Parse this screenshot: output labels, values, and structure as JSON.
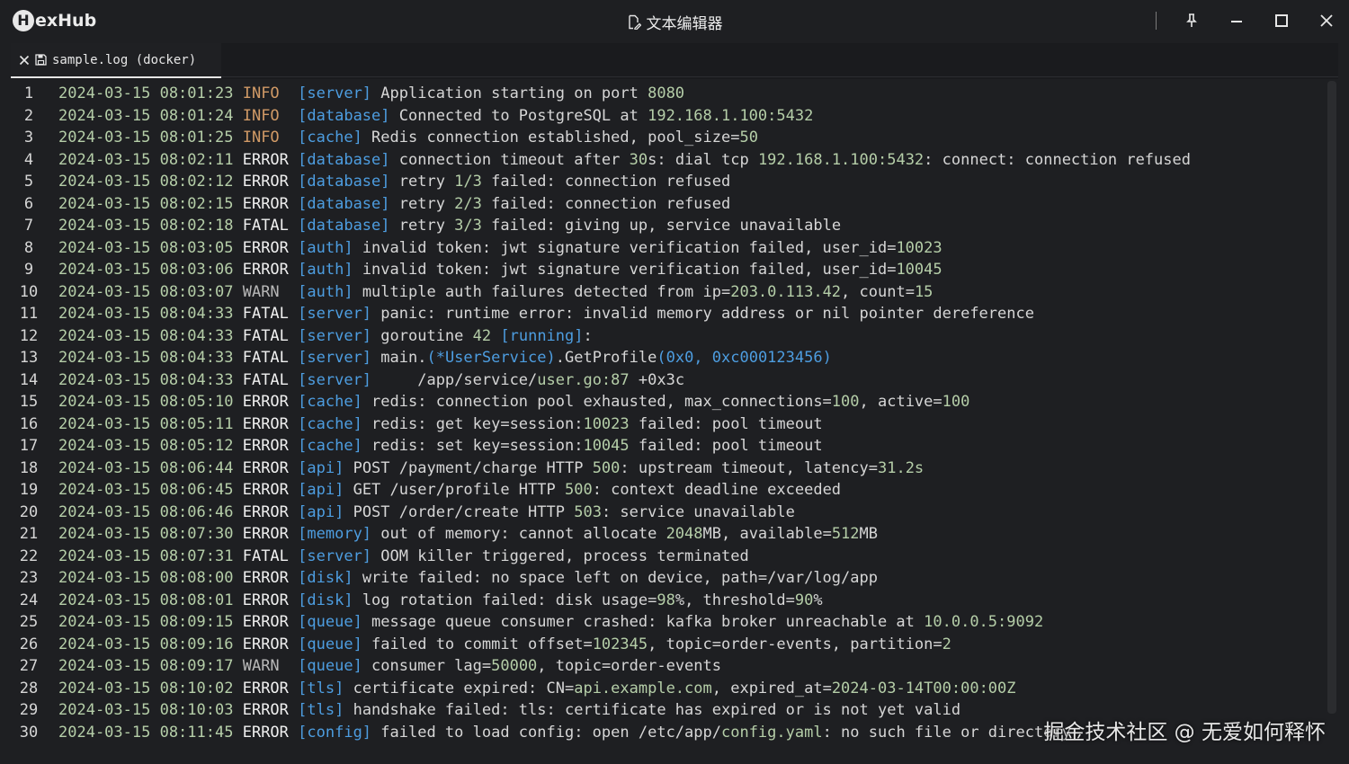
{
  "app": {
    "brand_mark": "H",
    "brand_text": "exHub",
    "window_title": "文本编辑器"
  },
  "tab": {
    "label": "sample.log (docker)"
  },
  "watermark": "掘金技术社区 @ 无爱如何释怀",
  "lines": [
    {
      "n": "1",
      "segs": [
        [
          "ts",
          "2024-03-15 08:01:23"
        ],
        [
          "plain",
          " "
        ],
        [
          "lv-INFO",
          "INFO "
        ],
        [
          "plain",
          " "
        ],
        [
          "tag",
          "[server]"
        ],
        [
          "plain",
          " Application starting on port "
        ],
        [
          "num",
          "8080"
        ]
      ]
    },
    {
      "n": "2",
      "segs": [
        [
          "ts",
          "2024-03-15 08:01:24"
        ],
        [
          "plain",
          " "
        ],
        [
          "lv-INFO",
          "INFO "
        ],
        [
          "plain",
          " "
        ],
        [
          "tag",
          "[database]"
        ],
        [
          "plain",
          " Connected to PostgreSQL at "
        ],
        [
          "num",
          "192.168.1.100:5432"
        ]
      ]
    },
    {
      "n": "3",
      "segs": [
        [
          "ts",
          "2024-03-15 08:01:25"
        ],
        [
          "plain",
          " "
        ],
        [
          "lv-INFO",
          "INFO "
        ],
        [
          "plain",
          " "
        ],
        [
          "tag",
          "[cache]"
        ],
        [
          "plain",
          " Redis connection established, pool_size="
        ],
        [
          "num",
          "50"
        ]
      ]
    },
    {
      "n": "4",
      "segs": [
        [
          "ts",
          "2024-03-15 08:02:11"
        ],
        [
          "plain",
          " "
        ],
        [
          "lv-ERROR",
          "ERROR"
        ],
        [
          "plain",
          " "
        ],
        [
          "tag",
          "[database]"
        ],
        [
          "plain",
          " connection timeout after "
        ],
        [
          "num",
          "30"
        ],
        [
          "plain",
          "s: dial tcp "
        ],
        [
          "num",
          "192.168.1.100:5432"
        ],
        [
          "plain",
          ": connect: connection refused"
        ]
      ]
    },
    {
      "n": "5",
      "segs": [
        [
          "ts",
          "2024-03-15 08:02:12"
        ],
        [
          "plain",
          " "
        ],
        [
          "lv-ERROR",
          "ERROR"
        ],
        [
          "plain",
          " "
        ],
        [
          "tag",
          "[database]"
        ],
        [
          "plain",
          " retry "
        ],
        [
          "num",
          "1/3"
        ],
        [
          "plain",
          " failed: connection refused"
        ]
      ]
    },
    {
      "n": "6",
      "segs": [
        [
          "ts",
          "2024-03-15 08:02:15"
        ],
        [
          "plain",
          " "
        ],
        [
          "lv-ERROR",
          "ERROR"
        ],
        [
          "plain",
          " "
        ],
        [
          "tag",
          "[database]"
        ],
        [
          "plain",
          " retry "
        ],
        [
          "num",
          "2/3"
        ],
        [
          "plain",
          " failed: connection refused"
        ]
      ]
    },
    {
      "n": "7",
      "segs": [
        [
          "ts",
          "2024-03-15 08:02:18"
        ],
        [
          "plain",
          " "
        ],
        [
          "lv-FATAL",
          "FATAL"
        ],
        [
          "plain",
          " "
        ],
        [
          "tag",
          "[database]"
        ],
        [
          "plain",
          " retry "
        ],
        [
          "num",
          "3/3"
        ],
        [
          "plain",
          " failed: giving up, service unavailable"
        ]
      ]
    },
    {
      "n": "8",
      "segs": [
        [
          "ts",
          "2024-03-15 08:03:05"
        ],
        [
          "plain",
          " "
        ],
        [
          "lv-ERROR",
          "ERROR"
        ],
        [
          "plain",
          " "
        ],
        [
          "tag",
          "[auth]"
        ],
        [
          "plain",
          " invalid token: jwt signature verification failed, user_id="
        ],
        [
          "num",
          "10023"
        ]
      ]
    },
    {
      "n": "9",
      "segs": [
        [
          "ts",
          "2024-03-15 08:03:06"
        ],
        [
          "plain",
          " "
        ],
        [
          "lv-ERROR",
          "ERROR"
        ],
        [
          "plain",
          " "
        ],
        [
          "tag",
          "[auth]"
        ],
        [
          "plain",
          " invalid token: jwt signature verification failed, user_id="
        ],
        [
          "num",
          "10045"
        ]
      ]
    },
    {
      "n": "10",
      "segs": [
        [
          "ts",
          "2024-03-15 08:03:07"
        ],
        [
          "plain",
          " "
        ],
        [
          "lv-WARN",
          "WARN "
        ],
        [
          "plain",
          " "
        ],
        [
          "tag",
          "[auth]"
        ],
        [
          "plain",
          " multiple auth failures detected from ip="
        ],
        [
          "num",
          "203.0.113.42"
        ],
        [
          "plain",
          ", count="
        ],
        [
          "num",
          "15"
        ]
      ]
    },
    {
      "n": "11",
      "segs": [
        [
          "ts",
          "2024-03-15 08:04:33"
        ],
        [
          "plain",
          " "
        ],
        [
          "lv-FATAL",
          "FATAL"
        ],
        [
          "plain",
          " "
        ],
        [
          "tag",
          "[server]"
        ],
        [
          "plain",
          " panic: runtime error: invalid memory address or nil pointer dereference"
        ]
      ]
    },
    {
      "n": "12",
      "segs": [
        [
          "ts",
          "2024-03-15 08:04:33"
        ],
        [
          "plain",
          " "
        ],
        [
          "lv-FATAL",
          "FATAL"
        ],
        [
          "plain",
          " "
        ],
        [
          "tag",
          "[server]"
        ],
        [
          "plain",
          " goroutine "
        ],
        [
          "num",
          "42"
        ],
        [
          "plain",
          " "
        ],
        [
          "tag",
          "[running]"
        ],
        [
          "plain",
          ":"
        ]
      ]
    },
    {
      "n": "13",
      "segs": [
        [
          "ts",
          "2024-03-15 08:04:33"
        ],
        [
          "plain",
          " "
        ],
        [
          "lv-FATAL",
          "FATAL"
        ],
        [
          "plain",
          " "
        ],
        [
          "tag",
          "[server]"
        ],
        [
          "plain",
          " main."
        ],
        [
          "blue",
          "(*UserService)"
        ],
        [
          "plain",
          ".GetProfile"
        ],
        [
          "blue",
          "(0x0, 0xc000123456)"
        ]
      ]
    },
    {
      "n": "14",
      "segs": [
        [
          "ts",
          "2024-03-15 08:04:33"
        ],
        [
          "plain",
          " "
        ],
        [
          "lv-FATAL",
          "FATAL"
        ],
        [
          "plain",
          " "
        ],
        [
          "tag",
          "[server]"
        ],
        [
          "plain",
          "     /app/service/"
        ],
        [
          "num",
          "user.go:87"
        ],
        [
          "plain",
          " +0x3c"
        ]
      ]
    },
    {
      "n": "15",
      "segs": [
        [
          "ts",
          "2024-03-15 08:05:10"
        ],
        [
          "plain",
          " "
        ],
        [
          "lv-ERROR",
          "ERROR"
        ],
        [
          "plain",
          " "
        ],
        [
          "tag",
          "[cache]"
        ],
        [
          "plain",
          " redis: connection pool exhausted, max_connections="
        ],
        [
          "num",
          "100"
        ],
        [
          "plain",
          ", active="
        ],
        [
          "num",
          "100"
        ]
      ]
    },
    {
      "n": "16",
      "segs": [
        [
          "ts",
          "2024-03-15 08:05:11"
        ],
        [
          "plain",
          " "
        ],
        [
          "lv-ERROR",
          "ERROR"
        ],
        [
          "plain",
          " "
        ],
        [
          "tag",
          "[cache]"
        ],
        [
          "plain",
          " redis: get key=session:"
        ],
        [
          "num",
          "10023"
        ],
        [
          "plain",
          " failed: pool timeout"
        ]
      ]
    },
    {
      "n": "17",
      "segs": [
        [
          "ts",
          "2024-03-15 08:05:12"
        ],
        [
          "plain",
          " "
        ],
        [
          "lv-ERROR",
          "ERROR"
        ],
        [
          "plain",
          " "
        ],
        [
          "tag",
          "[cache]"
        ],
        [
          "plain",
          " redis: set key=session:"
        ],
        [
          "num",
          "10045"
        ],
        [
          "plain",
          " failed: pool timeout"
        ]
      ]
    },
    {
      "n": "18",
      "segs": [
        [
          "ts",
          "2024-03-15 08:06:44"
        ],
        [
          "plain",
          " "
        ],
        [
          "lv-ERROR",
          "ERROR"
        ],
        [
          "plain",
          " "
        ],
        [
          "tag",
          "[api]"
        ],
        [
          "plain",
          " POST /payment/charge HTTP "
        ],
        [
          "num",
          "500"
        ],
        [
          "plain",
          ": upstream timeout, latency="
        ],
        [
          "num",
          "31.2s"
        ]
      ]
    },
    {
      "n": "19",
      "segs": [
        [
          "ts",
          "2024-03-15 08:06:45"
        ],
        [
          "plain",
          " "
        ],
        [
          "lv-ERROR",
          "ERROR"
        ],
        [
          "plain",
          " "
        ],
        [
          "tag",
          "[api]"
        ],
        [
          "plain",
          " GET /user/profile HTTP "
        ],
        [
          "num",
          "500"
        ],
        [
          "plain",
          ": context deadline exceeded"
        ]
      ]
    },
    {
      "n": "20",
      "segs": [
        [
          "ts",
          "2024-03-15 08:06:46"
        ],
        [
          "plain",
          " "
        ],
        [
          "lv-ERROR",
          "ERROR"
        ],
        [
          "plain",
          " "
        ],
        [
          "tag",
          "[api]"
        ],
        [
          "plain",
          " POST /order/create HTTP "
        ],
        [
          "num",
          "503"
        ],
        [
          "plain",
          ": service unavailable"
        ]
      ]
    },
    {
      "n": "21",
      "segs": [
        [
          "ts",
          "2024-03-15 08:07:30"
        ],
        [
          "plain",
          " "
        ],
        [
          "lv-ERROR",
          "ERROR"
        ],
        [
          "plain",
          " "
        ],
        [
          "tag",
          "[memory]"
        ],
        [
          "plain",
          " out of memory: cannot allocate "
        ],
        [
          "num",
          "2048"
        ],
        [
          "plain",
          "MB, available="
        ],
        [
          "num",
          "512"
        ],
        [
          "plain",
          "MB"
        ]
      ]
    },
    {
      "n": "22",
      "segs": [
        [
          "ts",
          "2024-03-15 08:07:31"
        ],
        [
          "plain",
          " "
        ],
        [
          "lv-FATAL",
          "FATAL"
        ],
        [
          "plain",
          " "
        ],
        [
          "tag",
          "[server]"
        ],
        [
          "plain",
          " OOM killer triggered, process terminated"
        ]
      ]
    },
    {
      "n": "23",
      "segs": [
        [
          "ts",
          "2024-03-15 08:08:00"
        ],
        [
          "plain",
          " "
        ],
        [
          "lv-ERROR",
          "ERROR"
        ],
        [
          "plain",
          " "
        ],
        [
          "tag",
          "[disk]"
        ],
        [
          "plain",
          " write failed: no space left on device, path=/var/log/app"
        ]
      ]
    },
    {
      "n": "24",
      "segs": [
        [
          "ts",
          "2024-03-15 08:08:01"
        ],
        [
          "plain",
          " "
        ],
        [
          "lv-ERROR",
          "ERROR"
        ],
        [
          "plain",
          " "
        ],
        [
          "tag",
          "[disk]"
        ],
        [
          "plain",
          " log rotation failed: disk usage="
        ],
        [
          "num",
          "98"
        ],
        [
          "plain",
          "%, threshold="
        ],
        [
          "num",
          "90"
        ],
        [
          "plain",
          "%"
        ]
      ]
    },
    {
      "n": "25",
      "segs": [
        [
          "ts",
          "2024-03-15 08:09:15"
        ],
        [
          "plain",
          " "
        ],
        [
          "lv-ERROR",
          "ERROR"
        ],
        [
          "plain",
          " "
        ],
        [
          "tag",
          "[queue]"
        ],
        [
          "plain",
          " message queue consumer crashed: kafka broker unreachable at "
        ],
        [
          "num",
          "10.0.0.5:9092"
        ]
      ]
    },
    {
      "n": "26",
      "segs": [
        [
          "ts",
          "2024-03-15 08:09:16"
        ],
        [
          "plain",
          " "
        ],
        [
          "lv-ERROR",
          "ERROR"
        ],
        [
          "plain",
          " "
        ],
        [
          "tag",
          "[queue]"
        ],
        [
          "plain",
          " failed to commit offset="
        ],
        [
          "num",
          "102345"
        ],
        [
          "plain",
          ", topic=order-events, partition="
        ],
        [
          "num",
          "2"
        ]
      ]
    },
    {
      "n": "27",
      "segs": [
        [
          "ts",
          "2024-03-15 08:09:17"
        ],
        [
          "plain",
          " "
        ],
        [
          "lv-WARN",
          "WARN "
        ],
        [
          "plain",
          " "
        ],
        [
          "tag",
          "[queue]"
        ],
        [
          "plain",
          " consumer lag="
        ],
        [
          "num",
          "50000"
        ],
        [
          "plain",
          ", topic=order-events"
        ]
      ]
    },
    {
      "n": "28",
      "segs": [
        [
          "ts",
          "2024-03-15 08:10:02"
        ],
        [
          "plain",
          " "
        ],
        [
          "lv-ERROR",
          "ERROR"
        ],
        [
          "plain",
          " "
        ],
        [
          "tag",
          "[tls]"
        ],
        [
          "plain",
          " certificate expired: CN="
        ],
        [
          "num",
          "api.example.com"
        ],
        [
          "plain",
          ", expired_at="
        ],
        [
          "num",
          "2024-03-14T00:00:00Z"
        ]
      ]
    },
    {
      "n": "29",
      "segs": [
        [
          "ts",
          "2024-03-15 08:10:03"
        ],
        [
          "plain",
          " "
        ],
        [
          "lv-ERROR",
          "ERROR"
        ],
        [
          "plain",
          " "
        ],
        [
          "tag",
          "[tls]"
        ],
        [
          "plain",
          " handshake failed: tls: certificate has expired or is not yet valid"
        ]
      ]
    },
    {
      "n": "30",
      "segs": [
        [
          "ts",
          "2024-03-15 08:11:45"
        ],
        [
          "plain",
          " "
        ],
        [
          "lv-ERROR",
          "ERROR"
        ],
        [
          "plain",
          " "
        ],
        [
          "tag",
          "[config]"
        ],
        [
          "plain",
          " failed to load config: open /etc/app/"
        ],
        [
          "num",
          "config.yaml"
        ],
        [
          "plain",
          ": no such file or directory"
        ]
      ]
    }
  ]
}
